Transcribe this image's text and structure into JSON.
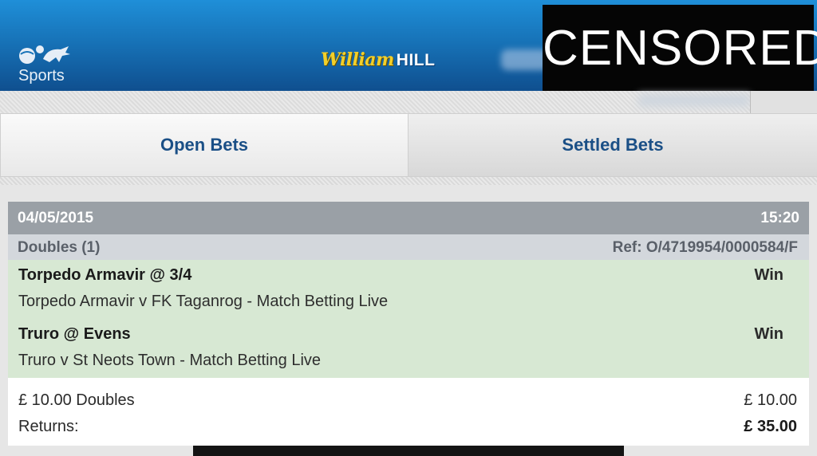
{
  "header": {
    "sports_label": "Sports",
    "logo_script": "William",
    "logo_bold": "HILL",
    "redaction_label": "CENSORED"
  },
  "tabs": [
    {
      "label": "Open Bets"
    },
    {
      "label": "Settled Bets"
    }
  ],
  "bet": {
    "date": "04/05/2015",
    "time": "15:20",
    "type": "Doubles (1)",
    "ref": "Ref: O/4719954/0000584/F",
    "selections": [
      {
        "name": "Torpedo Armavir @ 3/4",
        "result": "Win",
        "event": "Torpedo Armavir v FK Taganrog - Match Betting Live"
      },
      {
        "name": "Truro @ Evens",
        "result": "Win",
        "event": "Truro v St Neots Town - Match Betting Live"
      }
    ],
    "stake_label": "£ 10.00 Doubles",
    "stake_value": "£ 10.00",
    "returns_label": "Returns:",
    "returns_value": "£ 35.00"
  },
  "colors": {
    "header_blue": "#1773b8",
    "tab_text": "#1a4f86",
    "win_background": "#d7e8d3",
    "date_bar": "#9aa0a6"
  }
}
